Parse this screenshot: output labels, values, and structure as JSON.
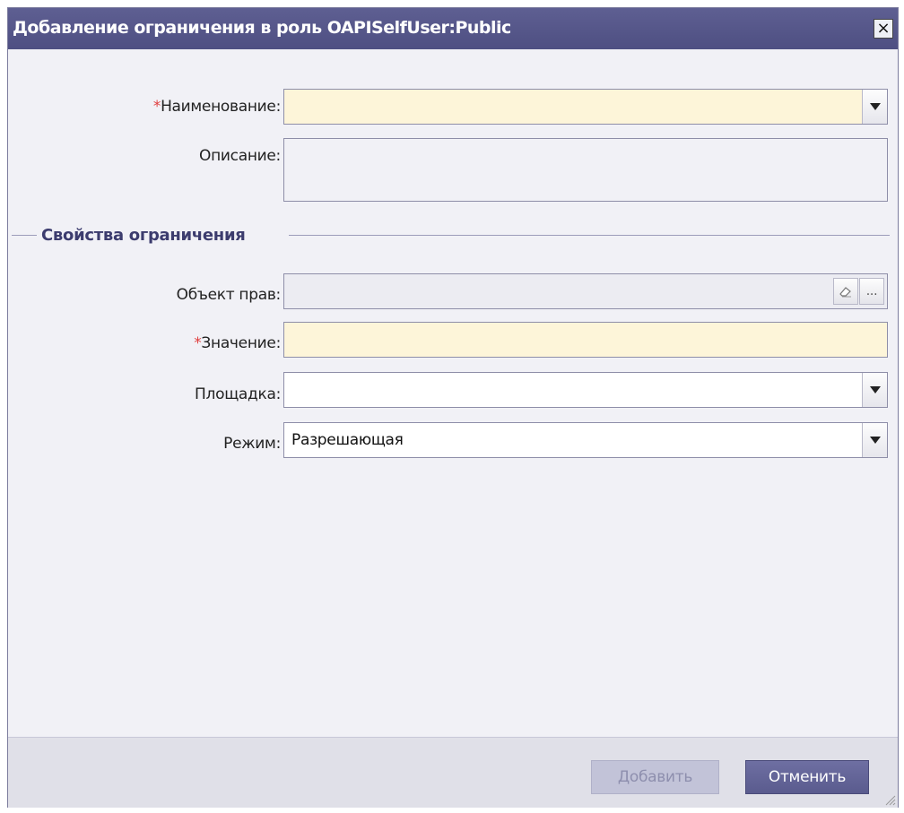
{
  "dialog": {
    "title": "Добавление ограничения в роль OAPISelfUser:Public",
    "close_label": "×"
  },
  "form": {
    "name": {
      "required_mark": "*",
      "label": "Наименование:",
      "value": ""
    },
    "description": {
      "label": "Описание:",
      "value": ""
    },
    "fieldset_legend": "Свойства ограничения",
    "rights_object": {
      "label": "Объект прав:",
      "value": "",
      "clear_icon": "eraser-icon",
      "browse_label": "..."
    },
    "value": {
      "required_mark": "*",
      "label": "Значение:",
      "value": ""
    },
    "site": {
      "label": "Площадка:",
      "value": ""
    },
    "mode": {
      "label": "Режим:",
      "value": "Разрешающая"
    }
  },
  "footer": {
    "add_label": "Добавить",
    "cancel_label": "Отменить"
  },
  "colors": {
    "title_bar": "#5e5f92",
    "required_bg": "#fdf5d9",
    "accent": "#5a5b8e",
    "required_mark": "#e04040"
  }
}
